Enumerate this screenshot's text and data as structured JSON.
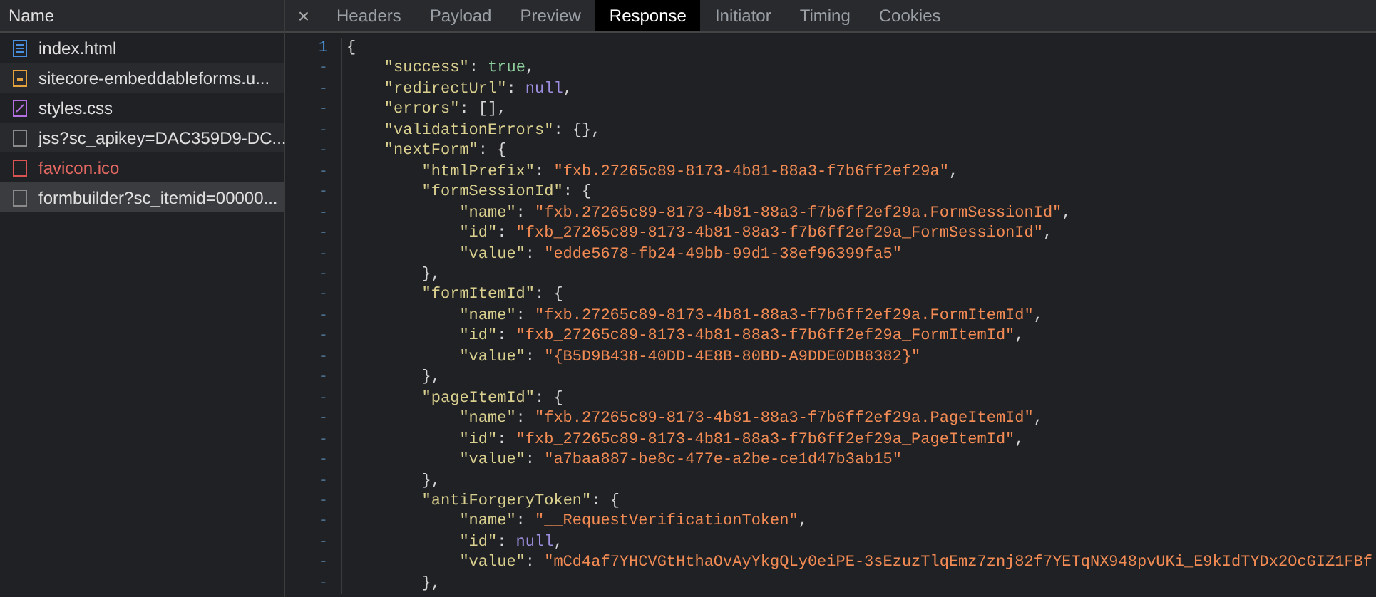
{
  "requests": {
    "header": "Name",
    "items": [
      {
        "name": "index.html",
        "kind": "document",
        "failed": false,
        "selected": false
      },
      {
        "name": "sitecore-embeddableforms.u...",
        "kind": "script",
        "failed": false,
        "selected": false
      },
      {
        "name": "styles.css",
        "kind": "stylesheet",
        "failed": false,
        "selected": false
      },
      {
        "name": "jss?sc_apikey=DAC359D9-DC...",
        "kind": "other",
        "failed": false,
        "selected": false
      },
      {
        "name": "favicon.ico",
        "kind": "other",
        "failed": true,
        "selected": false
      },
      {
        "name": "formbuilder?sc_itemid=00000...",
        "kind": "other",
        "failed": false,
        "selected": true
      }
    ]
  },
  "tabs": {
    "close": "×",
    "items": [
      {
        "label": "Headers",
        "selected": false
      },
      {
        "label": "Payload",
        "selected": false
      },
      {
        "label": "Preview",
        "selected": false
      },
      {
        "label": "Response",
        "selected": true
      },
      {
        "label": "Initiator",
        "selected": false
      },
      {
        "label": "Timing",
        "selected": false
      },
      {
        "label": "Cookies",
        "selected": false
      }
    ]
  },
  "response": {
    "lines": [
      {
        "gutter": "1",
        "tokens": [
          {
            "kind": "punct",
            "text": "{"
          }
        ],
        "children": [
          {
            "gutter": "-",
            "tokens": [
              {
                "kind": "key",
                "text": "\"success\""
              },
              {
                "kind": "punct",
                "text": ": "
              },
              {
                "kind": "bool",
                "text": "true"
              },
              {
                "kind": "punct",
                "text": ","
              }
            ]
          },
          {
            "gutter": "-",
            "tokens": [
              {
                "kind": "key",
                "text": "\"redirectUrl\""
              },
              {
                "kind": "punct",
                "text": ": "
              },
              {
                "kind": "null",
                "text": "null"
              },
              {
                "kind": "punct",
                "text": ","
              }
            ]
          },
          {
            "gutter": "-",
            "tokens": [
              {
                "kind": "key",
                "text": "\"errors\""
              },
              {
                "kind": "punct",
                "text": ": [],"
              }
            ]
          },
          {
            "gutter": "-",
            "tokens": [
              {
                "kind": "key",
                "text": "\"validationErrors\""
              },
              {
                "kind": "punct",
                "text": ": {},"
              }
            ]
          },
          {
            "gutter": "-",
            "tokens": [
              {
                "kind": "key",
                "text": "\"nextForm\""
              },
              {
                "kind": "punct",
                "text": ": {"
              }
            ],
            "children": [
              {
                "gutter": "-",
                "tokens": [
                  {
                    "kind": "key",
                    "text": "\"htmlPrefix\""
                  },
                  {
                    "kind": "punct",
                    "text": ": "
                  },
                  {
                    "kind": "str",
                    "text": "\"fxb.27265c89-8173-4b81-88a3-f7b6ff2ef29a\""
                  },
                  {
                    "kind": "punct",
                    "text": ","
                  }
                ]
              },
              {
                "gutter": "-",
                "tokens": [
                  {
                    "kind": "key",
                    "text": "\"formSessionId\""
                  },
                  {
                    "kind": "punct",
                    "text": ": {"
                  }
                ],
                "children": [
                  {
                    "gutter": "-",
                    "tokens": [
                      {
                        "kind": "key",
                        "text": "\"name\""
                      },
                      {
                        "kind": "punct",
                        "text": ": "
                      },
                      {
                        "kind": "str",
                        "text": "\"fxb.27265c89-8173-4b81-88a3-f7b6ff2ef29a.FormSessionId\""
                      },
                      {
                        "kind": "punct",
                        "text": ","
                      }
                    ]
                  },
                  {
                    "gutter": "-",
                    "tokens": [
                      {
                        "kind": "key",
                        "text": "\"id\""
                      },
                      {
                        "kind": "punct",
                        "text": ": "
                      },
                      {
                        "kind": "str",
                        "text": "\"fxb_27265c89-8173-4b81-88a3-f7b6ff2ef29a_FormSessionId\""
                      },
                      {
                        "kind": "punct",
                        "text": ","
                      }
                    ]
                  },
                  {
                    "gutter": "-",
                    "tokens": [
                      {
                        "kind": "key",
                        "text": "\"value\""
                      },
                      {
                        "kind": "punct",
                        "text": ": "
                      },
                      {
                        "kind": "str",
                        "text": "\"edde5678-fb24-49bb-99d1-38ef96399fa5\""
                      }
                    ]
                  }
                ]
              },
              {
                "gutter": "-",
                "tokens": [
                  {
                    "kind": "punct",
                    "text": "},"
                  }
                ]
              },
              {
                "gutter": "-",
                "tokens": [
                  {
                    "kind": "key",
                    "text": "\"formItemId\""
                  },
                  {
                    "kind": "punct",
                    "text": ": {"
                  }
                ],
                "children": [
                  {
                    "gutter": "-",
                    "tokens": [
                      {
                        "kind": "key",
                        "text": "\"name\""
                      },
                      {
                        "kind": "punct",
                        "text": ": "
                      },
                      {
                        "kind": "str",
                        "text": "\"fxb.27265c89-8173-4b81-88a3-f7b6ff2ef29a.FormItemId\""
                      },
                      {
                        "kind": "punct",
                        "text": ","
                      }
                    ]
                  },
                  {
                    "gutter": "-",
                    "tokens": [
                      {
                        "kind": "key",
                        "text": "\"id\""
                      },
                      {
                        "kind": "punct",
                        "text": ": "
                      },
                      {
                        "kind": "str",
                        "text": "\"fxb_27265c89-8173-4b81-88a3-f7b6ff2ef29a_FormItemId\""
                      },
                      {
                        "kind": "punct",
                        "text": ","
                      }
                    ]
                  },
                  {
                    "gutter": "-",
                    "tokens": [
                      {
                        "kind": "key",
                        "text": "\"value\""
                      },
                      {
                        "kind": "punct",
                        "text": ": "
                      },
                      {
                        "kind": "str",
                        "text": "\"{B5D9B438-40DD-4E8B-80BD-A9DDE0DB8382}\""
                      }
                    ]
                  }
                ]
              },
              {
                "gutter": "-",
                "tokens": [
                  {
                    "kind": "punct",
                    "text": "},"
                  }
                ]
              },
              {
                "gutter": "-",
                "tokens": [
                  {
                    "kind": "key",
                    "text": "\"pageItemId\""
                  },
                  {
                    "kind": "punct",
                    "text": ": {"
                  }
                ],
                "children": [
                  {
                    "gutter": "-",
                    "tokens": [
                      {
                        "kind": "key",
                        "text": "\"name\""
                      },
                      {
                        "kind": "punct",
                        "text": ": "
                      },
                      {
                        "kind": "str",
                        "text": "\"fxb.27265c89-8173-4b81-88a3-f7b6ff2ef29a.PageItemId\""
                      },
                      {
                        "kind": "punct",
                        "text": ","
                      }
                    ]
                  },
                  {
                    "gutter": "-",
                    "tokens": [
                      {
                        "kind": "key",
                        "text": "\"id\""
                      },
                      {
                        "kind": "punct",
                        "text": ": "
                      },
                      {
                        "kind": "str",
                        "text": "\"fxb_27265c89-8173-4b81-88a3-f7b6ff2ef29a_PageItemId\""
                      },
                      {
                        "kind": "punct",
                        "text": ","
                      }
                    ]
                  },
                  {
                    "gutter": "-",
                    "tokens": [
                      {
                        "kind": "key",
                        "text": "\"value\""
                      },
                      {
                        "kind": "punct",
                        "text": ": "
                      },
                      {
                        "kind": "str",
                        "text": "\"a7baa887-be8c-477e-a2be-ce1d47b3ab15\""
                      }
                    ]
                  }
                ]
              },
              {
                "gutter": "-",
                "tokens": [
                  {
                    "kind": "punct",
                    "text": "},"
                  }
                ]
              },
              {
                "gutter": "-",
                "tokens": [
                  {
                    "kind": "key",
                    "text": "\"antiForgeryToken\""
                  },
                  {
                    "kind": "punct",
                    "text": ": {"
                  }
                ],
                "children": [
                  {
                    "gutter": "-",
                    "tokens": [
                      {
                        "kind": "key",
                        "text": "\"name\""
                      },
                      {
                        "kind": "punct",
                        "text": ": "
                      },
                      {
                        "kind": "str",
                        "text": "\"__RequestVerificationToken\""
                      },
                      {
                        "kind": "punct",
                        "text": ","
                      }
                    ]
                  },
                  {
                    "gutter": "-",
                    "tokens": [
                      {
                        "kind": "key",
                        "text": "\"id\""
                      },
                      {
                        "kind": "punct",
                        "text": ": "
                      },
                      {
                        "kind": "null",
                        "text": "null"
                      },
                      {
                        "kind": "punct",
                        "text": ","
                      }
                    ]
                  },
                  {
                    "gutter": "-",
                    "tokens": [
                      {
                        "kind": "key",
                        "text": "\"value\""
                      },
                      {
                        "kind": "punct",
                        "text": ": "
                      },
                      {
                        "kind": "str",
                        "text": "\"mCd4af7YHCVGtHthaOvAyYkgQLy0eiPE-3sEzuzTlqEmz7znj82f7YETqNX948pvUKi_E9kIdTYDx2OcGIZ1FBf"
                      }
                    ]
                  }
                ]
              },
              {
                "gutter": "-",
                "tokens": [
                  {
                    "kind": "punct",
                    "text": "},"
                  }
                ]
              }
            ]
          }
        ]
      }
    ]
  }
}
